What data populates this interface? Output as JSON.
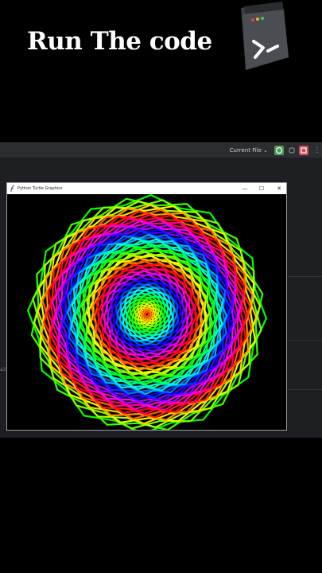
{
  "headline": "Run The code",
  "ide": {
    "run_config": "Current File ⌄",
    "more_label": "⋮",
    "side_text": "a3"
  },
  "turtle_window": {
    "title": "Python Turtle Graphics",
    "minimize": "—",
    "maximize": "☐",
    "close": "✕"
  },
  "colors": {
    "background": "#000000",
    "ide_toolbar": "#2b2d30",
    "run_button": "#4e9a5b",
    "stop_button": "#c94f5c"
  },
  "icons": [
    "terminal-app-icon",
    "python-feather-icon",
    "run-icon",
    "debug-icon",
    "stop-icon",
    "more-icon"
  ]
}
